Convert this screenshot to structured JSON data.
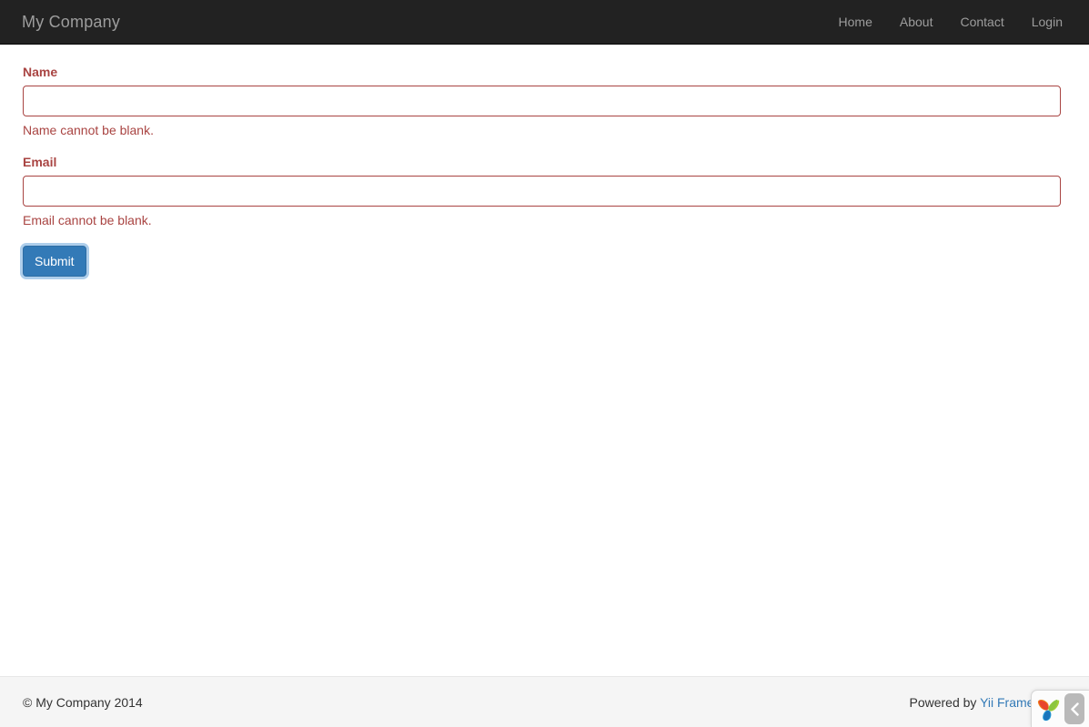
{
  "navbar": {
    "brand": "My Company",
    "links": [
      {
        "label": "Home",
        "name": "nav-link-home"
      },
      {
        "label": "About",
        "name": "nav-link-about"
      },
      {
        "label": "Contact",
        "name": "nav-link-contact"
      },
      {
        "label": "Login",
        "name": "nav-link-login"
      }
    ]
  },
  "form": {
    "fields": [
      {
        "label": "Name",
        "value": "",
        "placeholder": "",
        "error": "Name cannot be blank.",
        "state": "has-error"
      },
      {
        "label": "Email",
        "value": "",
        "placeholder": "",
        "error": "Email cannot be blank.",
        "state": "has-error"
      }
    ],
    "submit_label": "Submit"
  },
  "footer": {
    "copyright": "© My Company 2014",
    "powered_prefix": "Powered by ",
    "powered_link": "Yii Framework"
  },
  "widget": {
    "icon_name": "yii-logo-icon",
    "toggle_icon": "chevron-left-icon"
  },
  "colors": {
    "navbar_bg": "#222222",
    "navbar_text": "#9d9d9d",
    "error": "#a94442",
    "primary": "#337ab7",
    "primary_border": "#2e6da4",
    "footer_bg": "#f5f5f5",
    "footer_border": "#e7e7e7",
    "link": "#337ab7",
    "body_text": "#333333"
  }
}
